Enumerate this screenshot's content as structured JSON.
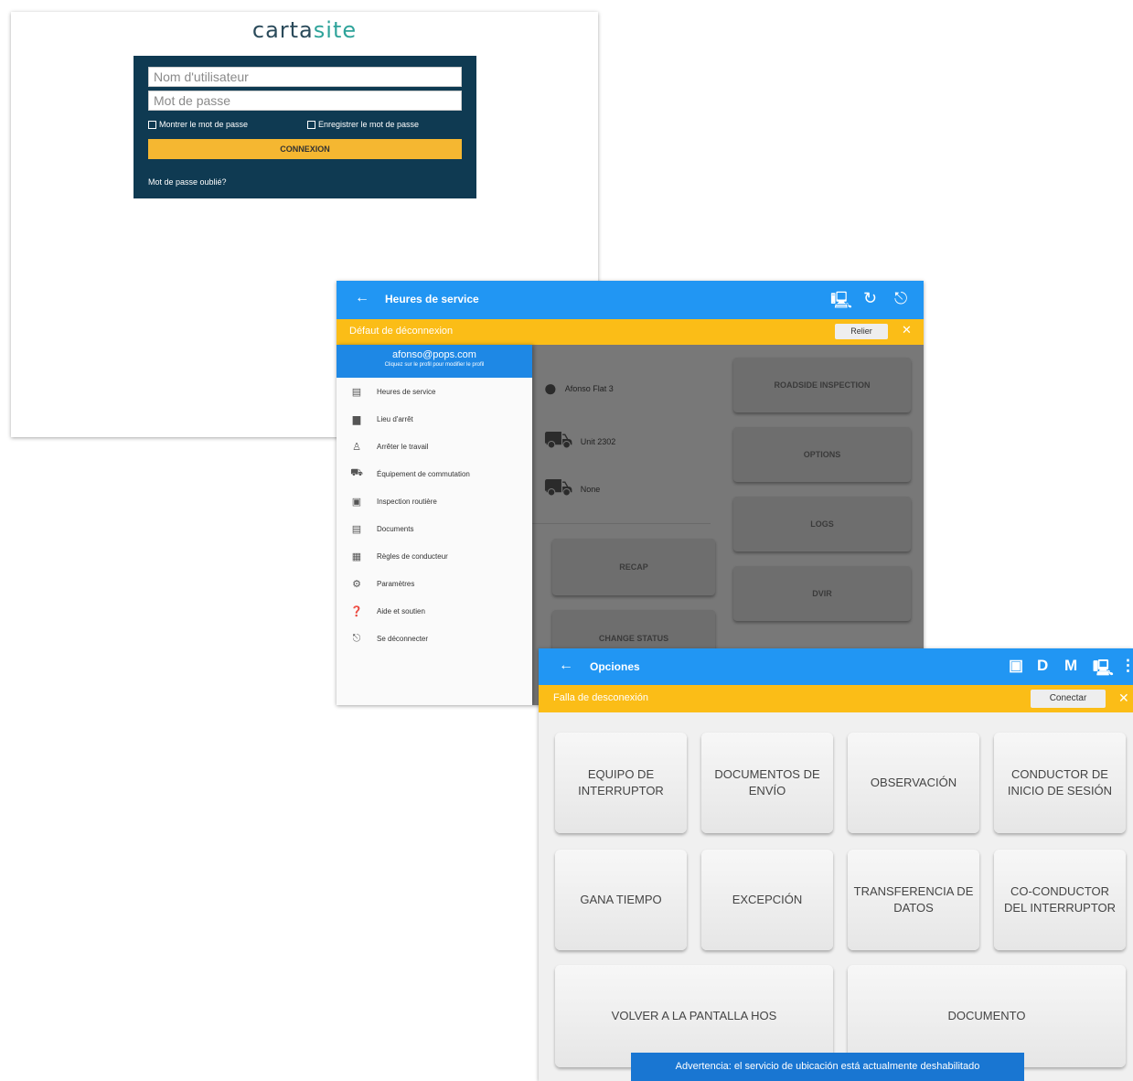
{
  "login": {
    "logo_a": "carta",
    "logo_b": "site",
    "username_placeholder": "Nom d'utilisateur",
    "password_placeholder": "Mot de passe",
    "show_password": "Montrer le mot de passe",
    "save_password": "Enregistrer le mot de passe",
    "connect": "CONNEXION",
    "forgot": "Mot de passe oublié?"
  },
  "hos": {
    "title": "Heures de service",
    "warning": "Défaut de déconnexion",
    "warning_button": "Relier",
    "drawer_email": "afonso@pops.com",
    "drawer_sub": "Cliquez sur le profil pour modifier le profil",
    "drawer_items": [
      {
        "icon": "hours-icon",
        "glyph": "▤",
        "label": "Heures de service"
      },
      {
        "icon": "work-icon",
        "glyph": "▆",
        "label": "Lieu d'arrêt"
      },
      {
        "icon": "driver-icon",
        "glyph": "♙",
        "label": "Arrêter le travail"
      },
      {
        "icon": "truck-icon",
        "glyph": "⛟",
        "label": "Équipement de commutation"
      },
      {
        "icon": "inspection-icon",
        "glyph": "▣",
        "label": "Inspection routière"
      },
      {
        "icon": "document-icon",
        "glyph": "▤",
        "label": "Documents"
      },
      {
        "icon": "rules-icon",
        "glyph": "▦",
        "label": "Règles de conducteur"
      },
      {
        "icon": "settings-icon",
        "glyph": "⚙",
        "label": "Paramètres"
      },
      {
        "icon": "help-icon",
        "glyph": "❓",
        "label": "Aide et soutien"
      },
      {
        "icon": "logout-icon",
        "glyph": "⎋",
        "label": "Se déconnecter"
      }
    ],
    "driver_name": "Afonso Flat 3",
    "vehicle": "Unit 2302",
    "trailer": "None",
    "tiles": {
      "roadside": "ROADSIDE INSPECTION",
      "options": "OPTIONS",
      "logs": "LOGS",
      "dvir": "DVIR",
      "recap": "RECAP",
      "extra": "CHANGE STATUS"
    }
  },
  "opc": {
    "title": "Opciones",
    "warning": "Falla de desconexión",
    "warning_button": "Conectar",
    "appbar_letters": [
      "D",
      "M"
    ],
    "tiles": [
      "EQUIPO DE INTERRUPTOR",
      "DOCUMENTOS DE ENVÍO",
      "OBSERVACIÓN",
      "CONDUCTOR DE INICIO DE SESIÓN",
      "GANA TIEMPO",
      "EXCEPCIÓN",
      "TRANSFERENCIA DE DATOS",
      "CO-CONDUCTOR DEL INTERRUPTOR",
      "VOLVER A LA PANTALLA HOS",
      "DOCUMENTO"
    ],
    "toast": "Advertencia: el servicio de ubicación está actualmente deshabilitado"
  }
}
